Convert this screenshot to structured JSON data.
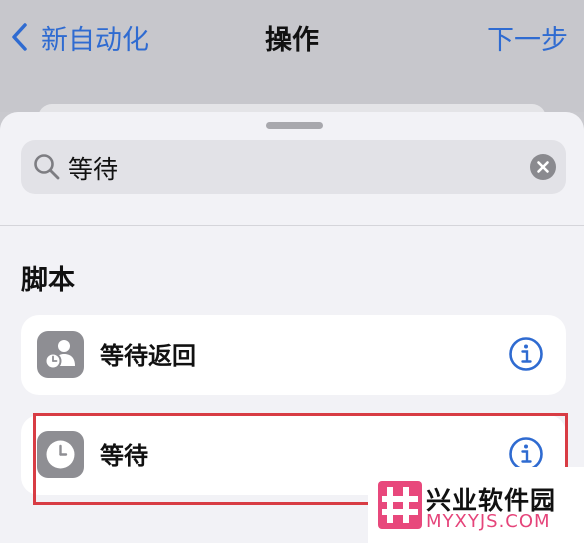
{
  "nav": {
    "back_label": "新自动化",
    "title": "操作",
    "next_label": "下一步"
  },
  "search": {
    "value": "等待"
  },
  "section": {
    "title": "脚本"
  },
  "actions": [
    {
      "label": "等待返回",
      "icon": "person-clock-icon"
    },
    {
      "label": "等待",
      "icon": "clock-icon"
    }
  ],
  "colors": {
    "accent": "#2f6bd1",
    "highlight": "#d83c44",
    "action_icon_bg": "#8e8e93"
  },
  "watermark": {
    "name": "兴业软件园",
    "domain": "MYXYJS.COM"
  }
}
